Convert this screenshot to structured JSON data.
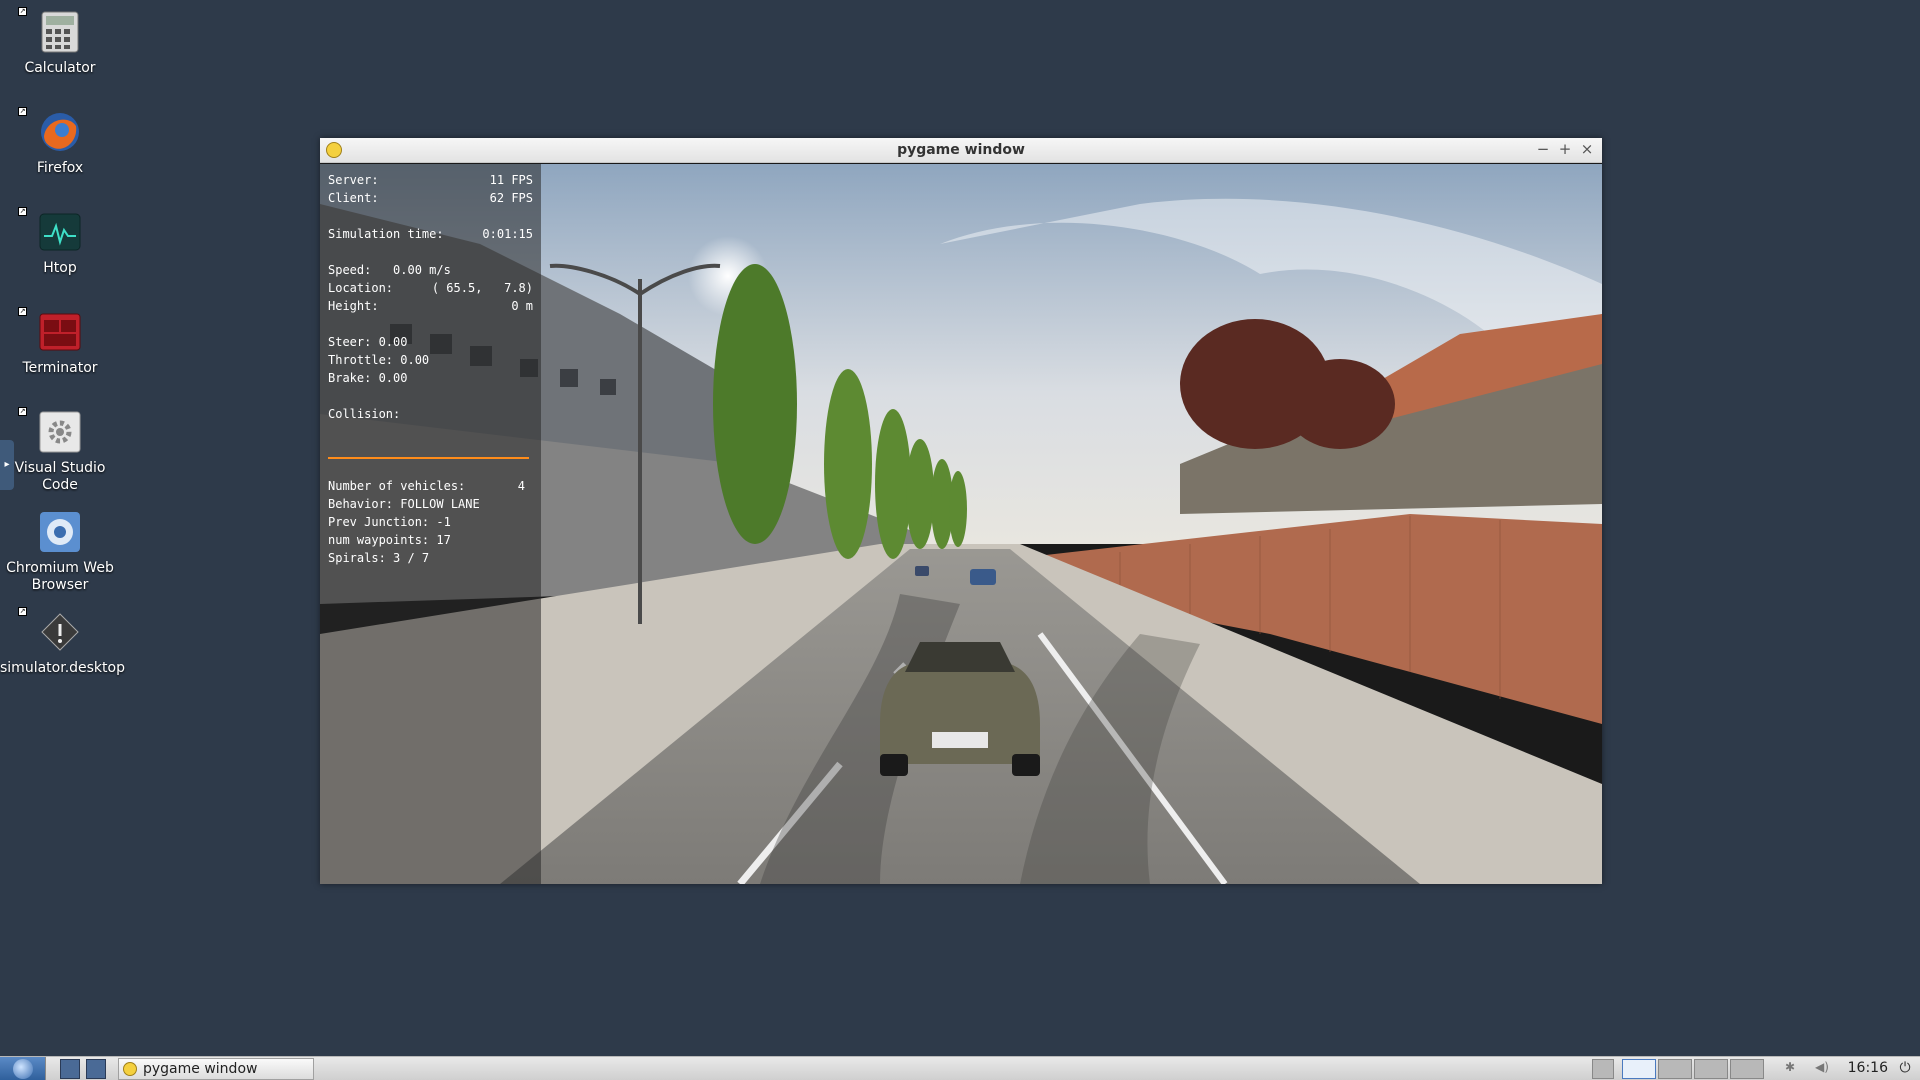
{
  "desktop": {
    "icons": [
      {
        "label": "Calculator",
        "icon": "calculator-icon"
      },
      {
        "label": "Firefox",
        "icon": "firefox-icon"
      },
      {
        "label": "Htop",
        "icon": "htop-icon"
      },
      {
        "label": "Terminator",
        "icon": "terminator-icon"
      },
      {
        "label": "Visual Studio Code",
        "icon": "gear-icon"
      },
      {
        "label": "Chromium Web Browser",
        "icon": "chromium-icon"
      },
      {
        "label": "simulator.desktop",
        "icon": "diamond-icon"
      }
    ]
  },
  "window": {
    "title": "pygame window",
    "buttons": {
      "minimize": "−",
      "maximize": "+",
      "close": "×"
    }
  },
  "hud": {
    "server_label": "Server:",
    "server_value": "11 FPS",
    "client_label": "Client:",
    "client_value": "62 FPS",
    "sim_time_label": "Simulation time:",
    "sim_time_value": "0:01:15",
    "speed": "Speed:   0.00 m/s",
    "location_label": "Location:",
    "location_value": "( 65.5,   7.8)",
    "height_label": "Height:",
    "height_value": "0 m",
    "steer": "Steer: 0.00",
    "throttle": "Throttle: 0.00",
    "brake": "Brake: 0.00",
    "collision": "Collision:",
    "vehicles_label": "Number of vehicles:",
    "vehicles_value": "4",
    "behavior": "Behavior: FOLLOW LANE",
    "prev_junction": "Prev Junction: -1",
    "num_waypoints": "num waypoints: 17",
    "spirals": "Spirals: 3 / 7"
  },
  "taskbar": {
    "task_label": "pygame window",
    "clock": "16:16",
    "accent": "#ff8c1a"
  }
}
